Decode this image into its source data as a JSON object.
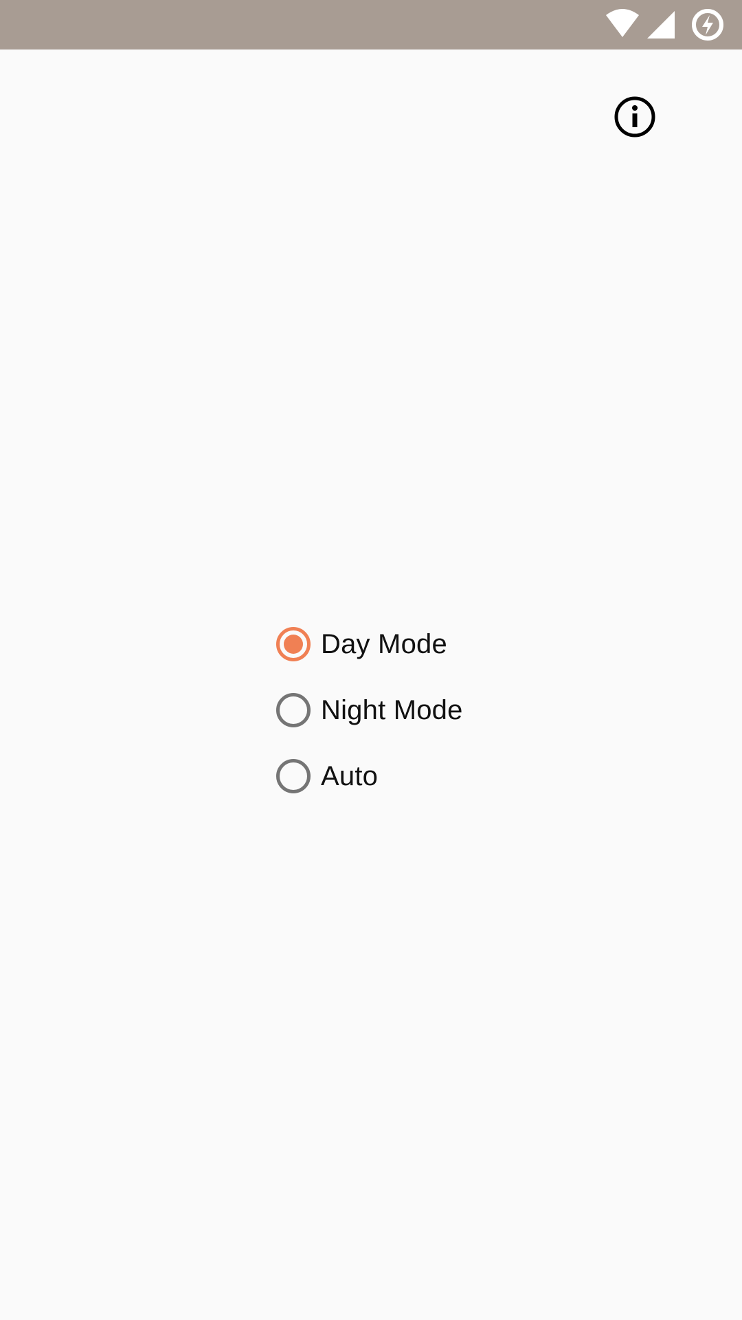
{
  "status_bar": {
    "background": "#A89C93",
    "icons": [
      "wifi-icon",
      "cellular-signal-icon",
      "battery-charging-icon"
    ]
  },
  "toolbar": {
    "info_icon": "info-icon"
  },
  "theme_options": {
    "accent_color": "#F08054",
    "items": [
      {
        "label": "Day Mode",
        "checked": true
      },
      {
        "label": "Night Mode",
        "checked": false
      },
      {
        "label": "Auto",
        "checked": false
      }
    ]
  }
}
